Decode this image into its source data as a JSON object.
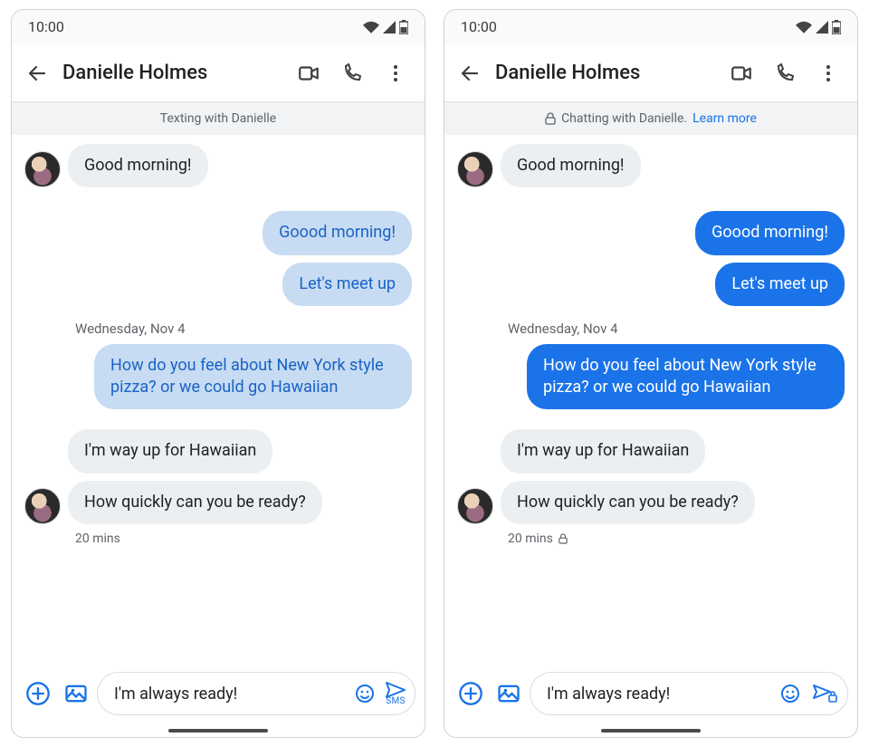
{
  "screens": [
    {
      "status_time": "10:00",
      "contact_name": "Danielle Holmes",
      "banner": {
        "lock": false,
        "text": "Texting with Danielle",
        "link": ""
      },
      "rcs": false,
      "date_label": "Wednesday, Nov 4",
      "messages": {
        "m0": "Good morning!",
        "m1": "Goood morning!",
        "m2": "Let's meet up",
        "m3": "How do you feel about New York style pizza? or we could go Hawaiian",
        "m4": "I'm way up for Hawaiian",
        "m5": "How quickly can you be ready?"
      },
      "timestamp": "20 mins",
      "timestamp_lock": false,
      "composer": {
        "input": "I'm always ready!",
        "send_mode": "SMS",
        "lock": false
      }
    },
    {
      "status_time": "10:00",
      "contact_name": "Danielle Holmes",
      "banner": {
        "lock": true,
        "text": "Chatting with Danielle.",
        "link": "Learn more"
      },
      "rcs": true,
      "date_label": "Wednesday, Nov 4",
      "messages": {
        "m0": "Good morning!",
        "m1": "Goood morning!",
        "m2": "Let's meet up",
        "m3": "How do you feel about New York style pizza? or we could go Hawaiian",
        "m4": "I'm way up for Hawaiian",
        "m5": "How quickly can you be ready?"
      },
      "timestamp": "20 mins",
      "timestamp_lock": true,
      "composer": {
        "input": "I'm always ready!",
        "send_mode": "",
        "lock": true
      }
    }
  ]
}
